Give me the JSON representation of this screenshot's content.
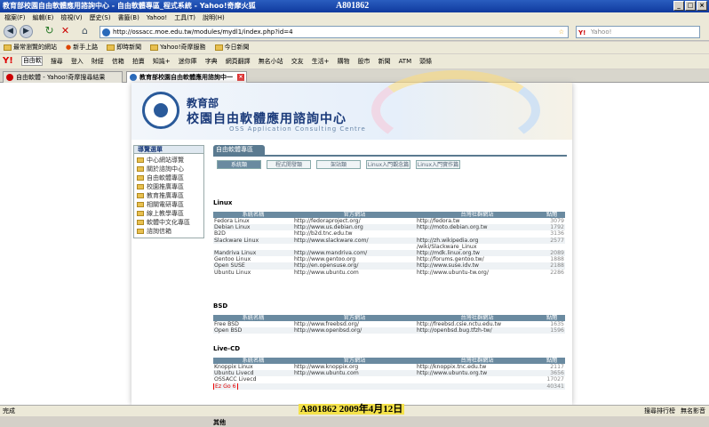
{
  "window": {
    "title": "教育部校園自由軟體應用諮詢中心 - 自由軟體專區_程式系統 - Yahoo!奇摩火狐",
    "watermark": "A801862"
  },
  "menu": [
    "檔案(F)",
    "編輯(E)",
    "檢視(V)",
    "歷史(S)",
    "書籤(B)",
    "Yahoo!",
    "工具(T)",
    "說明(H)"
  ],
  "nav": {
    "url": "http://ossacc.moe.edu.tw/modules/mydl1/index.php?id=4",
    "search_placeholder": "Yahoo!"
  },
  "bookmarks": [
    "最常瀏覽的網站",
    "新手上路",
    "即時新聞",
    "Yahoo!奇摩服務",
    "今日新聞"
  ],
  "ytoolbar": [
    "Y!",
    "自由軟",
    "搜尋",
    "登入",
    "財經",
    "信箱",
    "拍賣",
    "知識+",
    "迷你庫",
    "字典",
    "網頁翻譯",
    "無名小站",
    "交友",
    "生活+",
    "購物",
    "股市",
    "新聞",
    "ATM",
    "頭條"
  ],
  "tabs": [
    {
      "label": "自由軟體 - Yahoo!奇摩搜尋結果"
    },
    {
      "label": "教育部校園自由軟體應用諮詢中一"
    }
  ],
  "header": {
    "moe": "教育部",
    "center": "校園自由軟體應用諮詢中心",
    "english": "OSS Application Consulting Centre"
  },
  "sidebar": {
    "title": "導覽選單",
    "items": [
      "中心網站導覽",
      "關於諮詢中心",
      "自由軟體專區",
      "校園推廣專區",
      "教育推廣專區",
      "相關電研專區",
      "線上教學專區",
      "軟體中文化專區",
      "諮詢信箱"
    ]
  },
  "main": {
    "section_tab": "自由軟體專區",
    "subtabs": [
      "系統類",
      "程式開發類",
      "架站類",
      "Linux入門觀念篇",
      "Linux入門實作篇"
    ],
    "columns": [
      "系統名稱",
      "官方網站",
      "台灣社群網站",
      "點閱"
    ],
    "groups": [
      {
        "name": "Linux",
        "rows": [
          [
            "Fedora Linux",
            "http://fedoraproject.org/",
            "http://fedora.tw",
            "3079"
          ],
          [
            "Debian Linux",
            "http://www.us.debian.org",
            "http://moto.debian.org.tw",
            "1792"
          ],
          [
            "B2D",
            "http://b2d.tnc.edu.tw",
            "",
            "3136"
          ],
          [
            "Slackware Linux",
            "http://www.slackware.com/",
            "http://zh.wikipedia.org",
            "2577"
          ],
          [
            "",
            "",
            "/wiki/Slackware_Linux",
            ""
          ],
          [
            "Mandriva Linux",
            "http://www.mandriva.com/",
            "http://mdk.linux.org.tw",
            "2089"
          ],
          [
            "Gentoo Linux",
            "http://www.gentoo.org",
            "http://forums.gentoo.tw/",
            "1888"
          ],
          [
            "Open SUSE",
            "http://en.opensuse.org/",
            "http://www.suse.idv.tw",
            "2188"
          ],
          [
            "Ubuntu Linux",
            "http://www.ubuntu.com",
            "http://www.ubuntu-tw.org/",
            "2286"
          ]
        ]
      },
      {
        "name": "BSD",
        "rows": [
          [
            "Free BSD",
            "http://www.freebsd.org/",
            "http://freebsd.csie.nctu.edu.tw",
            "1635"
          ],
          [
            "Open BSD",
            "http://www.openbsd.org/",
            "http://openbsd.bug.tfzh-tw/",
            "1596"
          ]
        ]
      },
      {
        "name": "Live-CD",
        "rows": [
          [
            "Knoppix Linux",
            "http://www.knoppix.org",
            "http://knoppix.tnc.edu.tw",
            "2117"
          ],
          [
            "Ubuntu Livecd",
            "http://www.ubuntu.com",
            "http://www.ubuntu.org.tw",
            "3656"
          ],
          [
            "OSSACC Livecd",
            "",
            "",
            "17027"
          ],
          [
            "Ez Go 6",
            "",
            "",
            "40341"
          ]
        ]
      },
      {
        "name": "其他",
        "rows": []
      }
    ]
  },
  "status": {
    "left": "完成",
    "stamp": "A801862 2009年4月12日",
    "right": [
      "搜尋排行榜",
      "無名影音"
    ]
  },
  "colors": {
    "accent": "#6a8aa0",
    "highlight": "#e00000"
  }
}
